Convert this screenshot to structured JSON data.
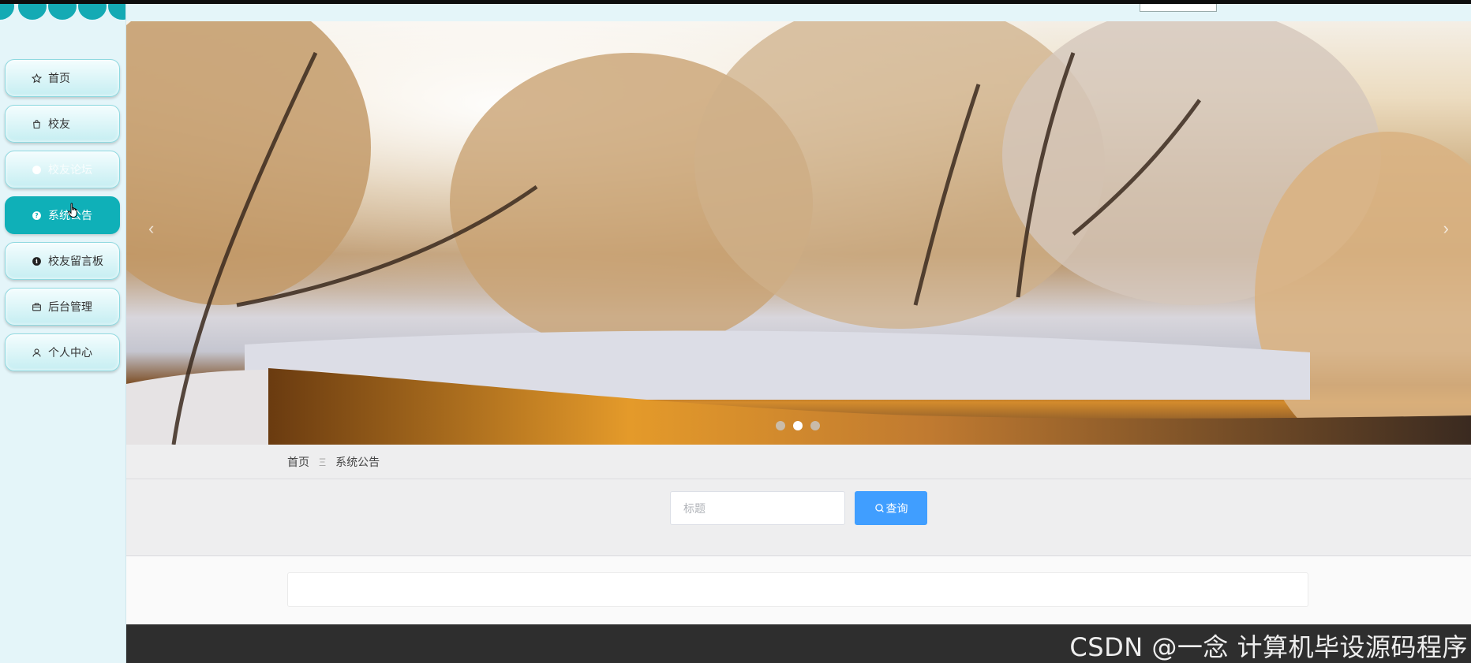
{
  "sidebar": {
    "items": [
      {
        "label": "首页",
        "icon": "star-icon"
      },
      {
        "label": "校友",
        "icon": "bag-icon"
      },
      {
        "label": "校友论坛",
        "icon": "info-circle-icon"
      },
      {
        "label": "系统公告",
        "icon": "question-circle-icon"
      },
      {
        "label": "校友留言板",
        "icon": "info-circle-icon"
      },
      {
        "label": "后台管理",
        "icon": "briefcase-icon"
      },
      {
        "label": "个人中心",
        "icon": "user-icon"
      }
    ],
    "active_index": 3,
    "accent_color": "#0fb0b8"
  },
  "banner": {
    "prev_label": "‹",
    "next_label": "›",
    "slide_count": 3,
    "active_slide": 1
  },
  "breadcrumb": {
    "home": "首页",
    "separator": "Ξ",
    "current": "系统公告"
  },
  "search": {
    "placeholder": "标题",
    "value": "",
    "button_label": "查询",
    "button_color": "#409eff"
  },
  "footer": {
    "watermark": "CSDN @一念 计算机毕设源码程序"
  }
}
